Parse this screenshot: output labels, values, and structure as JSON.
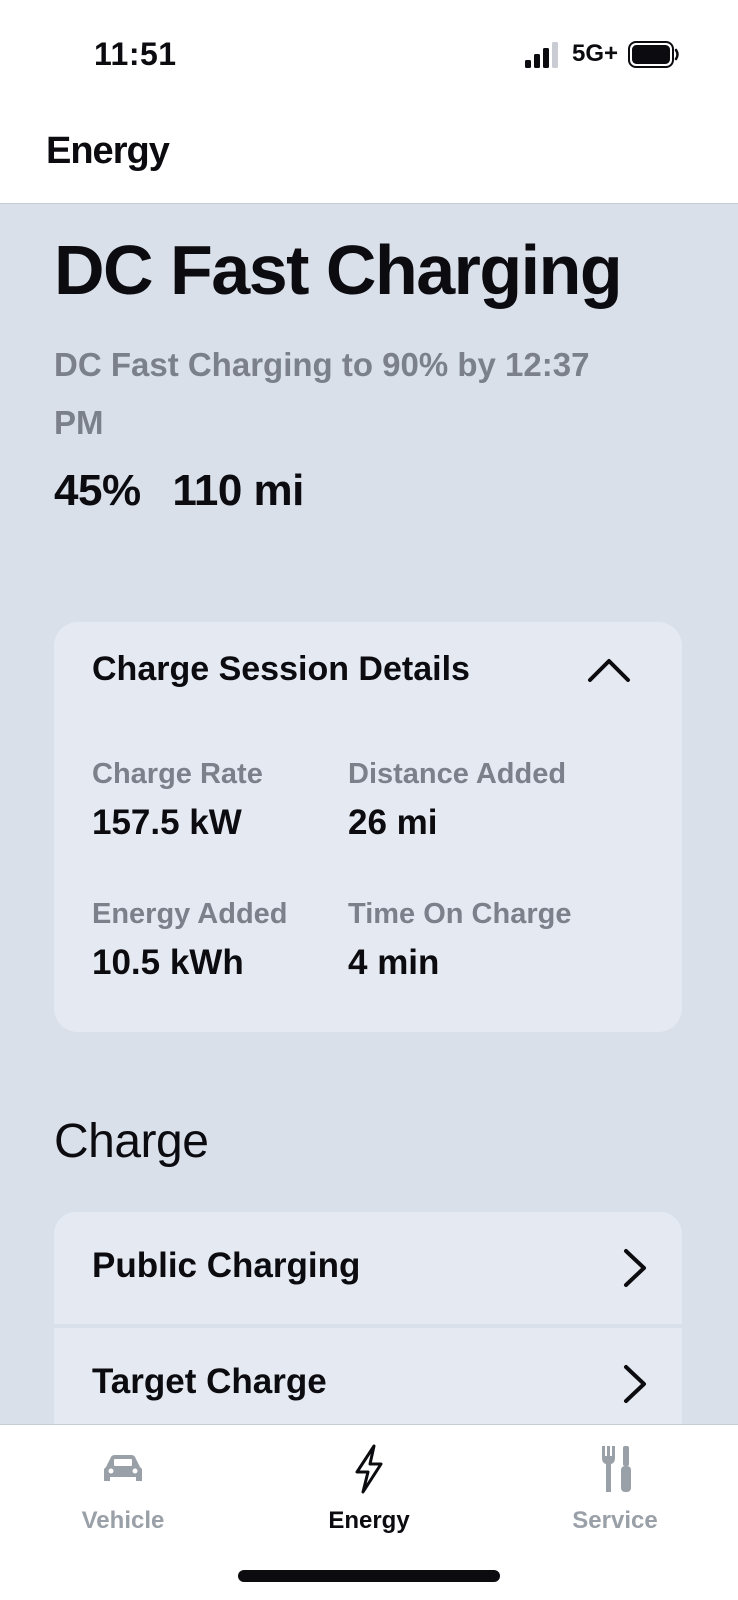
{
  "status_bar": {
    "time": "11:51",
    "network": "5G+",
    "icons": [
      "signal-icon",
      "battery-icon"
    ]
  },
  "header": {
    "title": "Energy"
  },
  "main": {
    "title": "DC Fast Charging",
    "status_text": "DC Fast Charging to 90% by 12:37 PM",
    "battery_percent": "45%",
    "range": "110 mi"
  },
  "details_card": {
    "title": "Charge Session Details",
    "expanded": true,
    "items": [
      {
        "label": "Charge Rate",
        "value": "157.5 kW"
      },
      {
        "label": "Distance Added",
        "value": "26 mi"
      },
      {
        "label": "Energy Added",
        "value": "10.5 kWh"
      },
      {
        "label": "Time On Charge",
        "value": "4 min"
      }
    ]
  },
  "charge_section": {
    "heading": "Charge",
    "items": [
      {
        "label": "Public Charging"
      },
      {
        "label": "Target Charge"
      }
    ]
  },
  "tab_bar": {
    "tabs": [
      {
        "label": "Vehicle",
        "icon": "car-icon",
        "active": false
      },
      {
        "label": "Energy",
        "icon": "bolt-icon",
        "active": true
      },
      {
        "label": "Service",
        "icon": "wrench-icon",
        "active": false
      }
    ]
  },
  "colors": {
    "background": "#dae0ea",
    "card": "#e5eaf2",
    "text": "#0c0c10",
    "muted_text": "#7b808a",
    "inactive_tab": "#9aa0a8"
  }
}
